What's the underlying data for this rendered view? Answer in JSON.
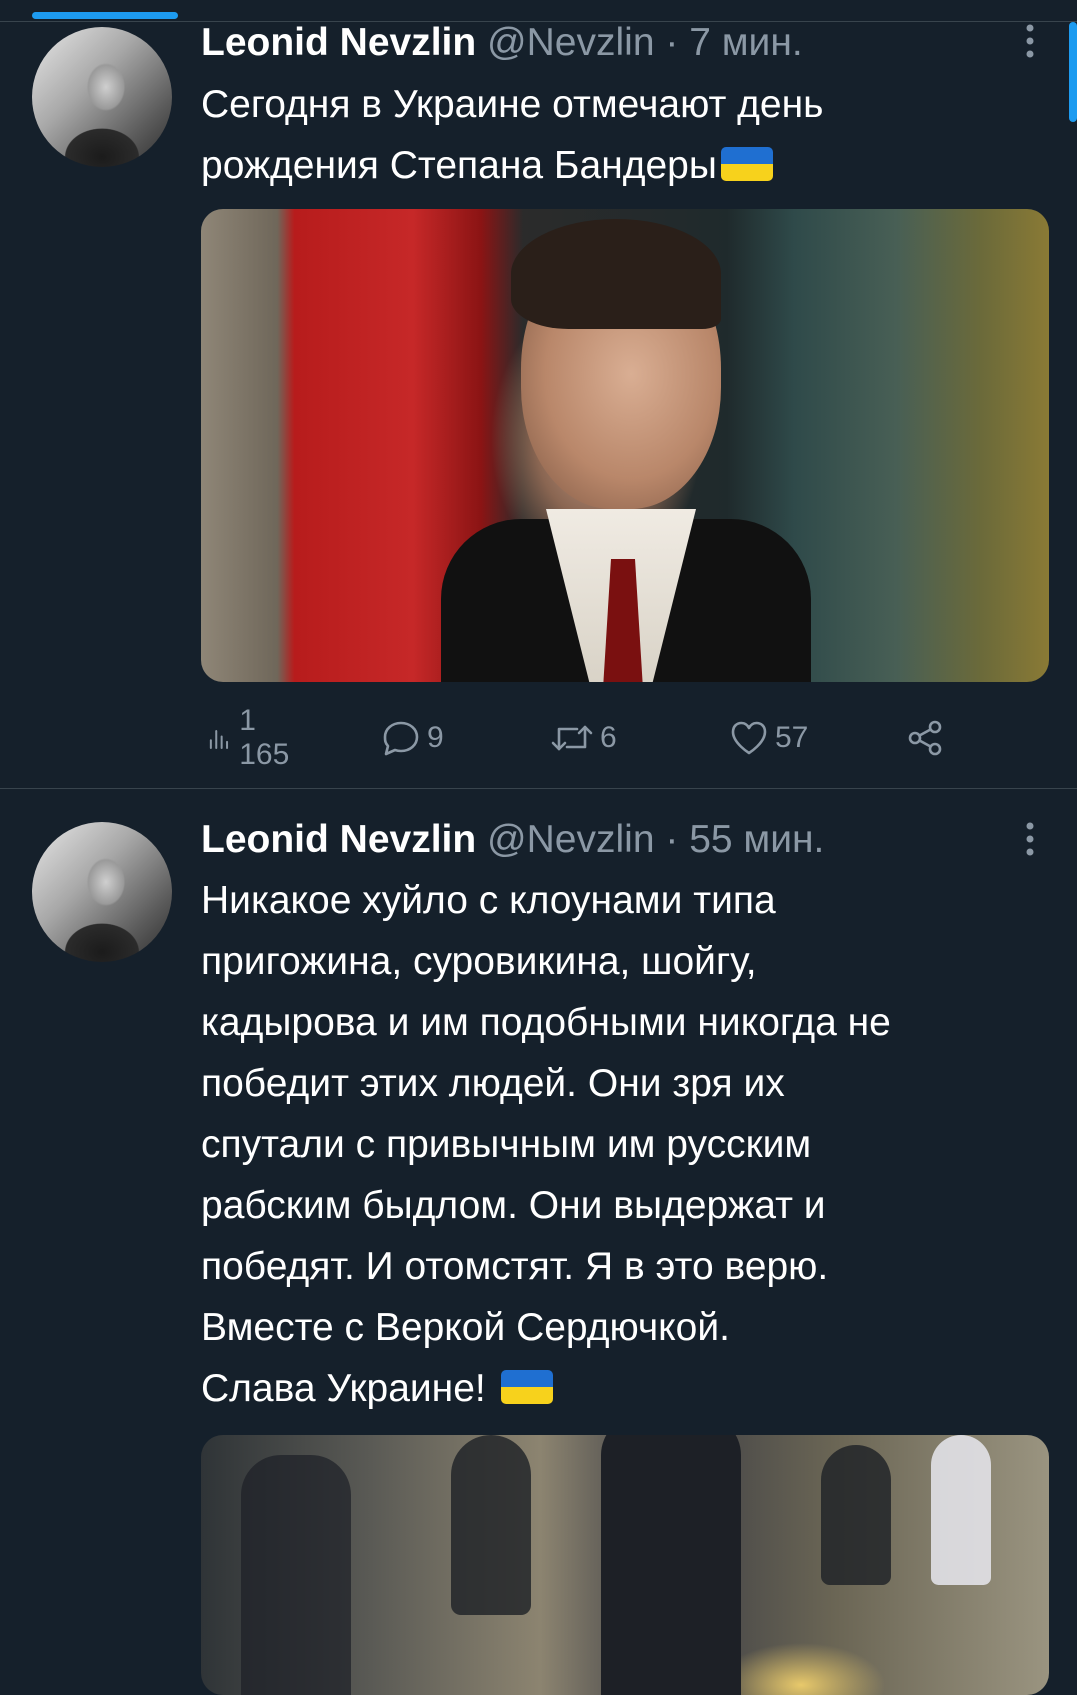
{
  "tweets": [
    {
      "author_name": "Leonid Nevzlin",
      "handle": "@Nevzlin",
      "separator": "·",
      "time": "7 мин.",
      "text_lines": [
        "Сегодня в Украине отмечают день",
        "рождения Степана Бандеры"
      ],
      "has_flag_emoji": true,
      "media": "photo",
      "actions": {
        "views": "1 165",
        "replies": "9",
        "retweets": "6",
        "likes": "57"
      }
    },
    {
      "author_name": "Leonid Nevzlin",
      "handle": "@Nevzlin",
      "separator": "·",
      "time": "55 мин.",
      "text_lines": [
        "Никакое хуйло с клоунами типа",
        "пригожина, суровикина, шойгу,",
        "кадырова и им подобными никогда не",
        "победит этих людей. Они зря их",
        "спутали с привычным им русским",
        "рабским быдлом. Они выдержат и",
        "победят. И отомстят. Я в это верю.",
        "Вместе с Веркой Сердючкой.",
        "Слава Украине!"
      ],
      "has_flag_emoji": true,
      "media": "video"
    }
  ],
  "icons": [
    "more-vertical-icon",
    "views-icon",
    "reply-icon",
    "retweet-icon",
    "like-icon",
    "share-icon",
    "ukraine-flag-emoji"
  ],
  "colors": {
    "background": "#15202b",
    "secondary_text": "#8b98a5",
    "accent": "#1d9bf0",
    "divider": "#38444d"
  }
}
